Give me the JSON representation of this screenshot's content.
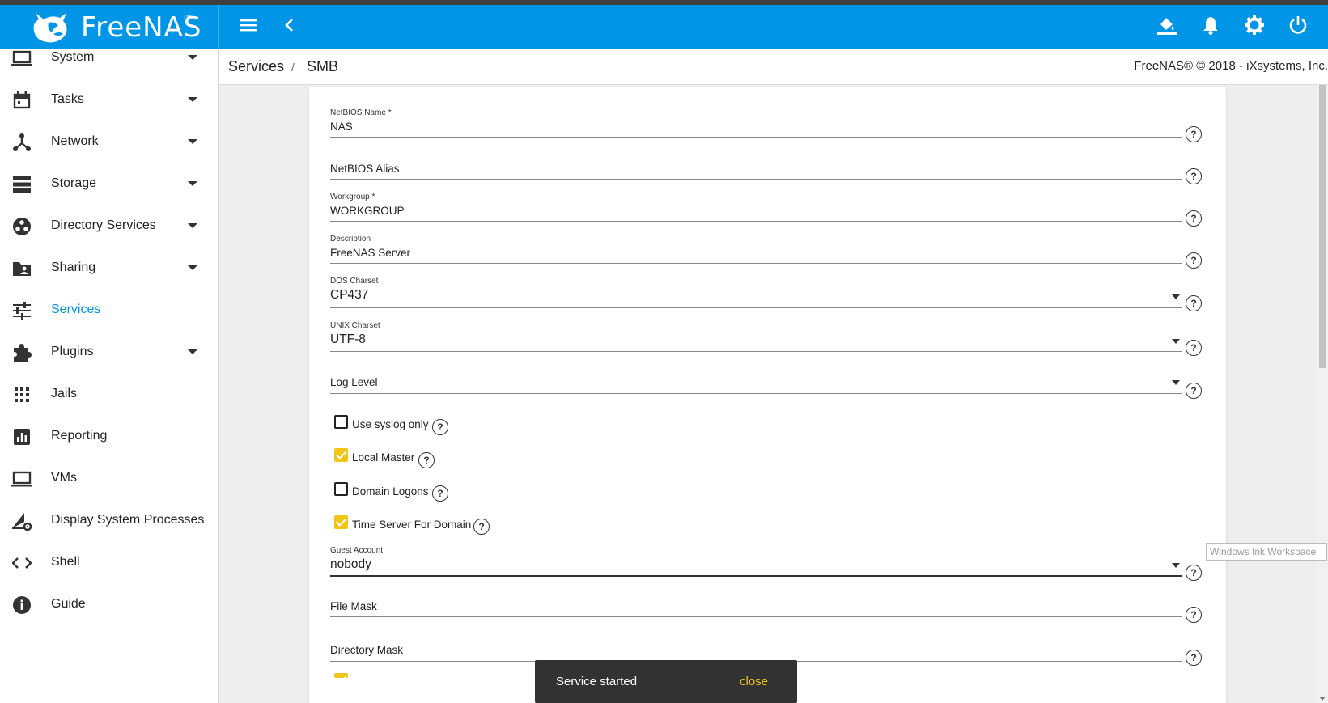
{
  "app": {
    "name": "FreeNAS",
    "tm": "TM"
  },
  "colors": {
    "topbar": "#0095e7",
    "accent": "#0095e7",
    "checkbox_on": "#f2c416",
    "snackbar": "#323232"
  },
  "topbar_icons": [
    "menu-icon",
    "back-chevron-icon",
    "theme-bucket-icon",
    "bell-icon",
    "gear-icon",
    "power-icon"
  ],
  "sidebar": {
    "items": [
      {
        "label": "System",
        "icon": "laptop-icon",
        "caret": true
      },
      {
        "label": "Tasks",
        "icon": "calendar-icon",
        "caret": true
      },
      {
        "label": "Network",
        "icon": "network-icon",
        "caret": true
      },
      {
        "label": "Storage",
        "icon": "storage-icon",
        "caret": true
      },
      {
        "label": "Directory Services",
        "icon": "directory-icon",
        "caret": true
      },
      {
        "label": "Sharing",
        "icon": "folder-shared-icon",
        "caret": true
      },
      {
        "label": "Services",
        "icon": "sliders-icon",
        "caret": false,
        "active": true
      },
      {
        "label": "Plugins",
        "icon": "puzzle-icon",
        "caret": true
      },
      {
        "label": "Jails",
        "icon": "grid-icon",
        "caret": false
      },
      {
        "label": "Reporting",
        "icon": "chart-icon",
        "caret": false
      },
      {
        "label": "VMs",
        "icon": "monitor-icon",
        "caret": false
      },
      {
        "label": "Display System Processes",
        "icon": "processes-icon",
        "caret": false
      },
      {
        "label": "Shell",
        "icon": "code-icon",
        "caret": false
      },
      {
        "label": "Guide",
        "icon": "info-icon",
        "caret": false
      }
    ]
  },
  "breadcrumb": {
    "parent": "Services",
    "separator": "/",
    "current": "SMB"
  },
  "copyright": "FreeNAS® © 2018 - iXsystems, Inc.",
  "form": {
    "netbios_name": {
      "label": "NetBIOS Name *",
      "value": "NAS"
    },
    "netbios_alias": {
      "label": "NetBIOS Alias"
    },
    "workgroup": {
      "label": "Workgroup *",
      "value": "WORKGROUP"
    },
    "description": {
      "label": "Description",
      "value": "FreeNAS Server"
    },
    "dos_charset": {
      "label": "DOS Charset",
      "value": "CP437"
    },
    "unix_charset": {
      "label": "UNIX Charset",
      "value": "UTF-8"
    },
    "log_level": {
      "label": "Log Level"
    },
    "use_syslog": {
      "label": "Use syslog only",
      "checked": false
    },
    "local_master": {
      "label": "Local Master",
      "checked": true
    },
    "domain_logons": {
      "label": "Domain Logons",
      "checked": false
    },
    "time_server": {
      "label": "Time Server For Domain",
      "checked": true
    },
    "guest_account": {
      "label": "Guest Account",
      "value": "nobody"
    },
    "file_mask": {
      "label": "File Mask"
    },
    "directory_mask": {
      "label": "Directory Mask"
    },
    "help_glyph": "?"
  },
  "ink_workspace": "Windows Ink Workspace",
  "snackbar": {
    "message": "Service started",
    "action": "close"
  }
}
